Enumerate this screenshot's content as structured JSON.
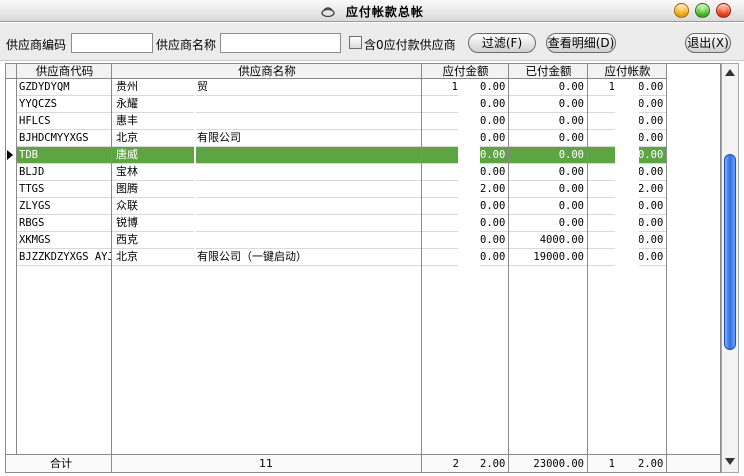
{
  "window": {
    "title": "应付帐款总帐",
    "colors": {
      "selected_row": "#5da443",
      "scroll_thumb": "#2f6ee0"
    }
  },
  "toolbar": {
    "supplier_code_label": "供应商编码",
    "supplier_code_value": "",
    "supplier_name_label": "供应商名称",
    "supplier_name_value": "",
    "include_zero_label": "含0应付款供应商",
    "filter_button": "过滤(F)",
    "detail_button": "查看明细(D)",
    "exit_button": "退出(X)"
  },
  "table": {
    "columns": [
      "供应商代码",
      "供应商名称",
      "应付金额",
      "已付金额",
      "应付帐款"
    ],
    "rows": [
      {
        "code": "GZDYDYQM",
        "name": "贵州",
        "name_tail": "贸",
        "payable_lead": "1",
        "payable": "0.00",
        "paid": "0.00",
        "balance_lead": "1",
        "balance": "0.00"
      },
      {
        "code": "YYQCZS",
        "name": "永耀",
        "name_tail": "",
        "payable_lead": "",
        "payable": "0.00",
        "paid": "0.00",
        "balance_lead": "",
        "balance": "0.00"
      },
      {
        "code": "HFLCS",
        "name": "惠丰",
        "name_tail": "",
        "payable_lead": "",
        "payable": "0.00",
        "paid": "0.00",
        "balance_lead": "",
        "balance": "0.00"
      },
      {
        "code": "BJHDCMYYXGS",
        "name": "北京",
        "name_tail": "有限公司",
        "payable_lead": "",
        "payable": "0.00",
        "paid": "0.00",
        "balance_lead": "",
        "balance": "0.00"
      },
      {
        "code": "TDB",
        "name": "唐威",
        "name_tail": "",
        "payable_lead": "",
        "payable": "0.00",
        "paid": "0.00",
        "balance_lead": "",
        "balance": "0.00",
        "selected": true
      },
      {
        "code": "BLJD",
        "name": "宝林",
        "name_tail": "",
        "payable_lead": "",
        "payable": "0.00",
        "paid": "0.00",
        "balance_lead": "",
        "balance": "0.00"
      },
      {
        "code": "TTGS",
        "name": "图腾",
        "name_tail": "",
        "payable_lead": "",
        "payable": "2.00",
        "paid": "0.00",
        "balance_lead": "",
        "balance": "2.00"
      },
      {
        "code": "ZLYGS",
        "name": "众联",
        "name_tail": "",
        "payable_lead": "",
        "payable": "0.00",
        "paid": "0.00",
        "balance_lead": "",
        "balance": "0.00"
      },
      {
        "code": "RBGS",
        "name": "锐博",
        "name_tail": "",
        "payable_lead": "",
        "payable": "0.00",
        "paid": "0.00",
        "balance_lead": "",
        "balance": "0.00"
      },
      {
        "code": "XKMGS",
        "name": "西克",
        "name_tail": "",
        "payable_lead": "",
        "payable": "0.00",
        "paid": "4000.00",
        "balance_lead": "",
        "balance": "0.00"
      },
      {
        "code": "BJZZKDZYXGS AYJ",
        "name": "北京",
        "name_tail": "有限公司（一键启动）",
        "payable_lead": "",
        "payable": "0.00",
        "paid": "19000.00",
        "balance_lead": "",
        "balance": "0.00"
      }
    ],
    "total": {
      "label": "合计",
      "count": "11",
      "payable_lead": "2",
      "payable": "2.00",
      "paid": "23000.00",
      "balance_lead": "1",
      "balance": "2.00"
    }
  }
}
